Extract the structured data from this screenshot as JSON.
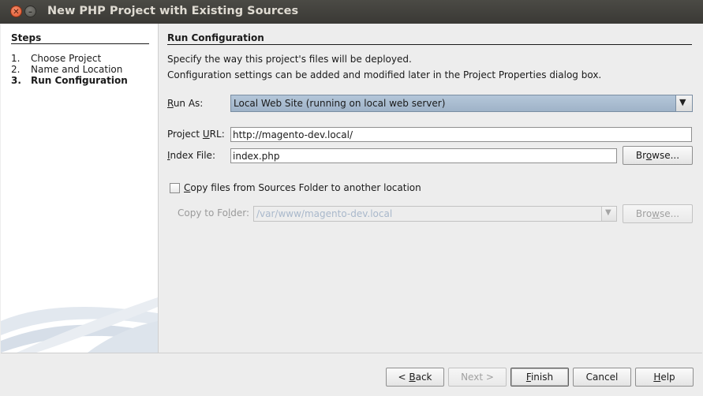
{
  "window": {
    "title": "New PHP Project with Existing Sources"
  },
  "steps": {
    "heading": "Steps",
    "items": [
      {
        "num": "1.",
        "label": "Choose Project",
        "current": false
      },
      {
        "num": "2.",
        "label": "Name and Location",
        "current": false
      },
      {
        "num": "3.",
        "label": "Run Configuration",
        "current": true
      }
    ]
  },
  "content": {
    "heading": "Run Configuration",
    "desc1": "Specify the way this project's files will be deployed.",
    "desc2": "Configuration settings can be added and modified later in the Project Properties dialog box."
  },
  "form": {
    "run_as_label": {
      "mnemonic": "R",
      "rest": "un As:"
    },
    "run_as_value": "Local Web Site (running on local web server)",
    "project_url_label": {
      "pre": "Project ",
      "mnemonic": "U",
      "rest": "RL:"
    },
    "project_url_value": "http://magento-dev.local/",
    "index_file_label": {
      "mnemonic": "I",
      "rest": "ndex File:"
    },
    "index_file_value": "index.php",
    "browse_index": {
      "pre": "Br",
      "mnemonic": "o",
      "rest": "wse..."
    },
    "copy_checkbox_label": {
      "mnemonic": "C",
      "rest": "opy files from Sources Folder to another location"
    },
    "copy_checkbox_checked": false,
    "copy_to_label": {
      "pre": "Copy to Fo",
      "mnemonic": "l",
      "rest": "der:"
    },
    "copy_to_value": "/var/www/magento-dev.local",
    "browse_copy": {
      "pre": "Bro",
      "mnemonic": "w",
      "rest": "se..."
    }
  },
  "footer": {
    "back": {
      "pre": "< ",
      "mnemonic": "B",
      "rest": "ack"
    },
    "next": "Next >",
    "finish": {
      "mnemonic": "F",
      "rest": "inish"
    },
    "cancel": "Cancel",
    "help": {
      "mnemonic": "H",
      "rest": "elp"
    }
  },
  "icons": {
    "close": "close-icon",
    "minimize": "minimize-icon",
    "dropdown": "chevron-down-icon"
  },
  "colors": {
    "titlebar": "#3c3b37",
    "selection": "#a9bcd0",
    "close_button": "#e65b32"
  }
}
